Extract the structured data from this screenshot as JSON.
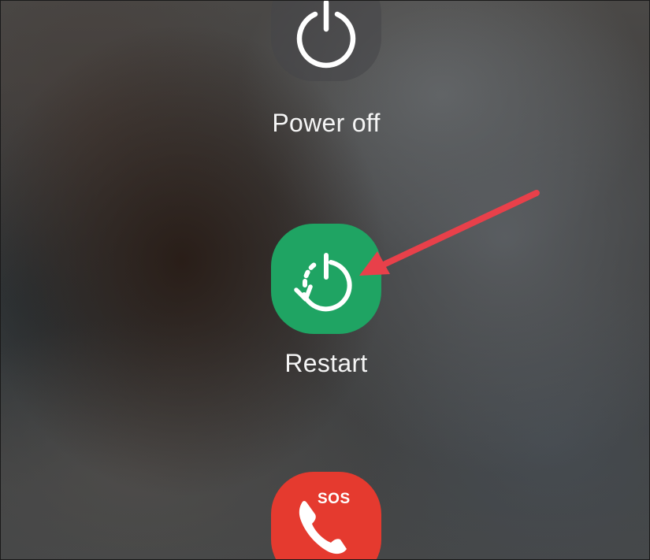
{
  "power_menu": {
    "power_off": {
      "label": "Power off",
      "icon": "power-icon",
      "color": "#464648"
    },
    "restart": {
      "label": "Restart",
      "icon": "restart-icon",
      "color": "#1fa463"
    },
    "sos": {
      "label": "SOS",
      "icon": "phone-icon",
      "color": "#e53a2f"
    }
  },
  "annotation": {
    "arrow_color": "#e8404a"
  }
}
